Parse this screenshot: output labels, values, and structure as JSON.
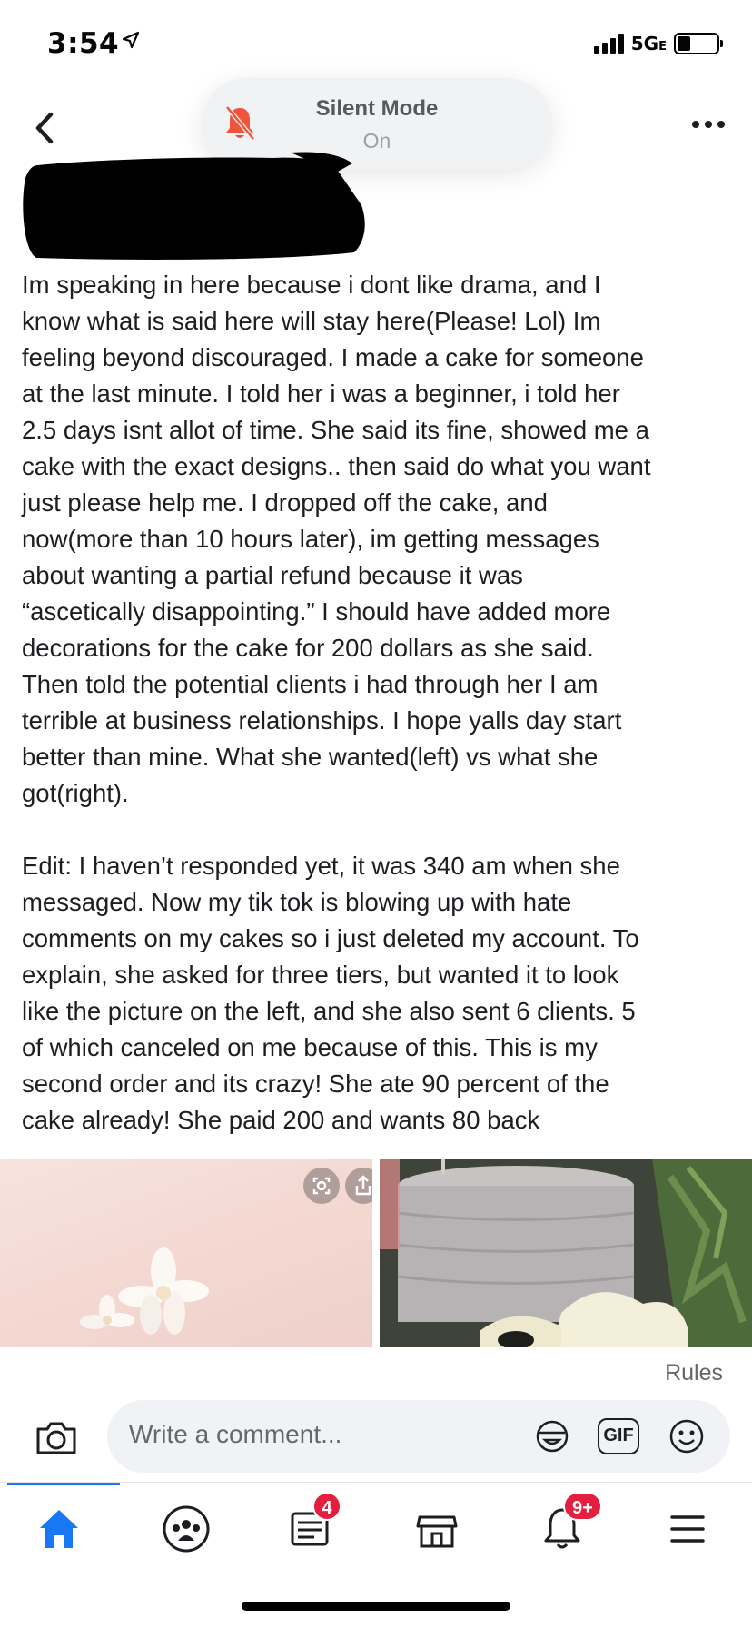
{
  "status_bar": {
    "time": "3:54",
    "network": "5G",
    "network_suffix": "E"
  },
  "silent_banner": {
    "title": "Silent Mode",
    "subtitle": "On"
  },
  "post": {
    "body": "Im speaking in here because i dont like drama, and I\nknow what is said here will stay here(Please! Lol) Im\nfeeling beyond discouraged. I made a cake for someone\nat the last minute. I told her i was a beginner, i told her\n2.5 days isnt allot of time. She said its fine, showed me a\ncake with the exact designs.. then said do what you want\njust please help me. I dropped off the cake, and\nnow(more than 10 hours later), im getting messages\nabout wanting a partial refund because it was\n“ascetically disappointing.” I should have added more\ndecorations for the cake for 200 dollars as she said.\nThen told the potential clients i had through her I am\nterrible at business relationships. I hope yalls day start\nbetter than mine. What she wanted(left) vs what she\ngot(right).\n\nEdit: I haven’t responded yet, it was 340 am when she\nmessaged. Now my tik tok is blowing up with hate\ncomments on my cakes so i just deleted my account. To\nexplain, she asked for three tiers, but wanted it to look\nlike the picture on the left, and she also sent 6 clients. 5\nof which canceled on me because of this. This is my\nsecond order and its crazy! She ate 90 percent of the\ncake already! She paid 200 and wants 80 back"
  },
  "rules_link": "Rules",
  "comment": {
    "placeholder": "Write a comment...",
    "gif_label": "GIF"
  },
  "tabbar": {
    "items": [
      {
        "icon": "home-icon",
        "active": true
      },
      {
        "icon": "groups-icon"
      },
      {
        "icon": "news-icon",
        "badge": "4"
      },
      {
        "icon": "marketplace-icon"
      },
      {
        "icon": "notifications-icon",
        "badge": "9+"
      },
      {
        "icon": "menu-icon"
      }
    ]
  },
  "colors": {
    "accent": "#1877f2",
    "badge": "#e41e3f",
    "silent_icon": "#f0543c"
  }
}
